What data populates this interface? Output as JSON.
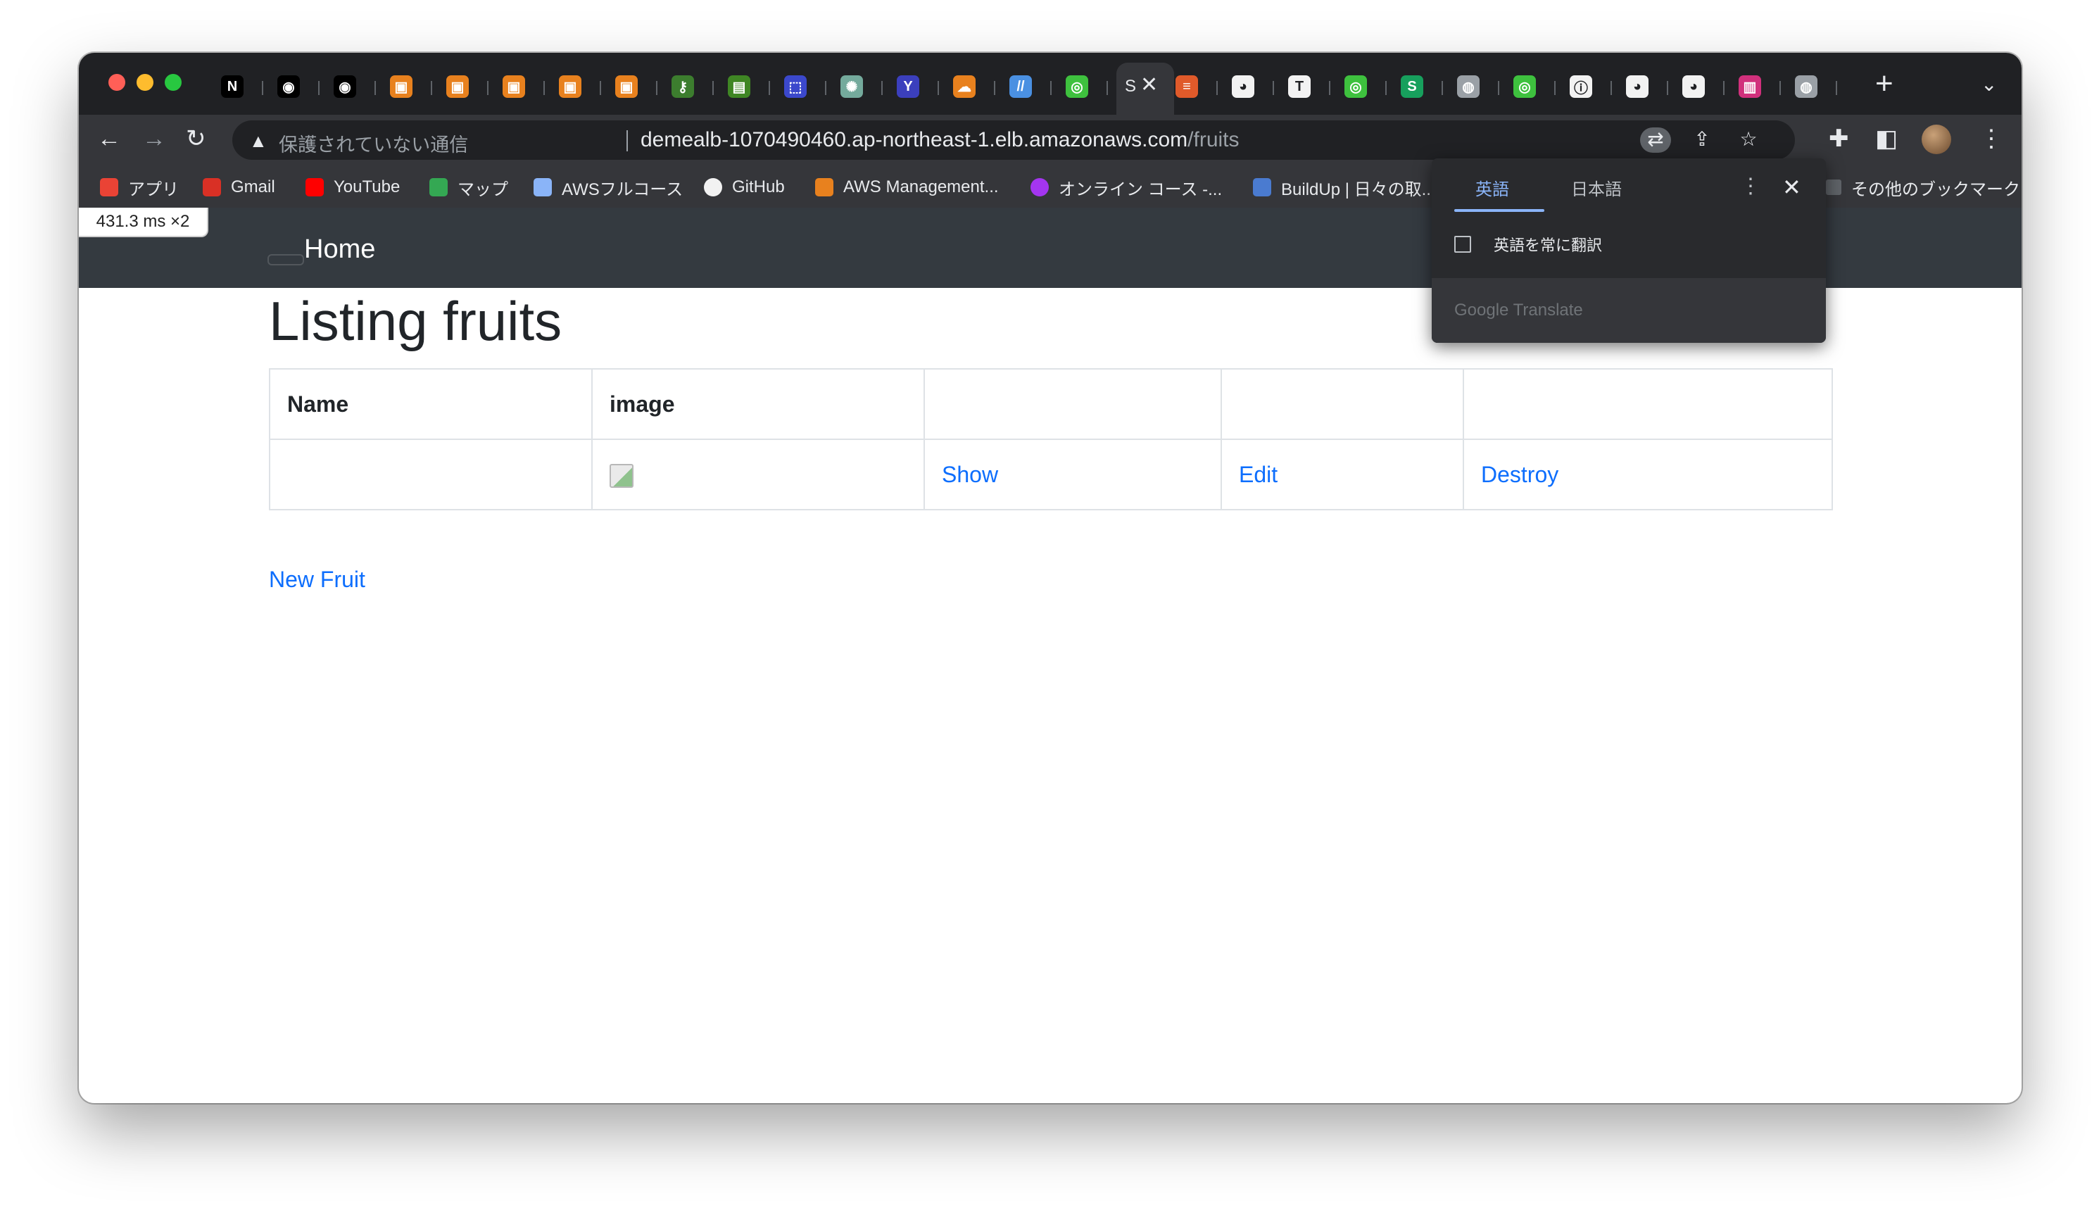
{
  "browser": {
    "tabs": [
      {
        "icon": "notion-icon",
        "color": "#000000",
        "glyph": "N"
      },
      {
        "icon": "github-icon",
        "color": "#000000",
        "glyph": "◉"
      },
      {
        "icon": "github-icon",
        "color": "#000000",
        "glyph": "◉"
      },
      {
        "icon": "aws-icon",
        "color": "#e8811e",
        "glyph": "▣"
      },
      {
        "icon": "aws-icon",
        "color": "#e8811e",
        "glyph": "▣"
      },
      {
        "icon": "aws-icon",
        "color": "#e8811e",
        "glyph": "▣"
      },
      {
        "icon": "aws-icon",
        "color": "#e8811e",
        "glyph": "▣"
      },
      {
        "icon": "aws-icon",
        "color": "#e8811e",
        "glyph": "▣"
      },
      {
        "icon": "key-icon",
        "color": "#3c7d2e",
        "glyph": "⚷"
      },
      {
        "icon": "aws-service-icon",
        "color": "#3f8624",
        "glyph": "▤"
      },
      {
        "icon": "aws-service-icon",
        "color": "#3b48cc",
        "glyph": "⬚"
      },
      {
        "icon": "openai-icon",
        "color": "#74aa9c",
        "glyph": "✺"
      },
      {
        "icon": "yahoo-icon",
        "color": "#3b3fbd",
        "glyph": "Y"
      },
      {
        "icon": "cloud-icon",
        "color": "#e8811e",
        "glyph": "☁"
      },
      {
        "icon": "slash-icon",
        "color": "#4a90e2",
        "glyph": "//"
      },
      {
        "icon": "green-circle-icon",
        "color": "#3ec13e",
        "glyph": "◎"
      },
      {
        "icon": "stackoverflow-icon",
        "color": "#e05a2a",
        "glyph": "≡"
      },
      {
        "icon": "chrome-icon",
        "color": "#f2f2f2",
        "glyph": "◕"
      },
      {
        "icon": "typora-icon",
        "color": "#f2f2f2",
        "glyph": "T"
      },
      {
        "icon": "green-circle-icon",
        "color": "#3ec13e",
        "glyph": "◎"
      },
      {
        "icon": "green-s-icon",
        "color": "#17a05d",
        "glyph": "S"
      },
      {
        "icon": "globe-icon",
        "color": "#9aa0a6",
        "glyph": "◍"
      },
      {
        "icon": "green-circle-icon",
        "color": "#3ec13e",
        "glyph": "◎"
      },
      {
        "icon": "info-icon",
        "color": "#f2f2f2",
        "glyph": "ⓘ"
      },
      {
        "icon": "chrome-icon",
        "color": "#f2f2f2",
        "glyph": "◕"
      },
      {
        "icon": "chrome-icon",
        "color": "#f2f2f2",
        "glyph": "◕"
      },
      {
        "icon": "trello-icon",
        "color": "#d1307c",
        "glyph": "▥"
      },
      {
        "icon": "globe-icon",
        "color": "#9aa0a6",
        "glyph": "◍"
      }
    ],
    "active_tab": {
      "dot": "S",
      "close": "✕"
    },
    "new_tab": "+",
    "security_label": "保護されていない通信",
    "url_host": "demealb-1070490460.ap-northeast-1.elb.amazonaws.com",
    "url_path": "/fruits",
    "bookmarks": [
      {
        "label": "アプリ",
        "icon": "apps-grid-icon",
        "color": "#ea4335"
      },
      {
        "label": "Gmail",
        "icon": "gmail-icon",
        "color": "#d93025"
      },
      {
        "label": "YouTube",
        "icon": "youtube-icon",
        "color": "#ff0000"
      },
      {
        "label": "マップ",
        "icon": "maps-icon",
        "color": "#34a853"
      },
      {
        "label": "AWSフルコース",
        "icon": "aws-course-icon",
        "color": "#8ab4f8"
      },
      {
        "label": "GitHub",
        "icon": "github-icon",
        "color": "#f2f2f2"
      },
      {
        "label": "AWS Management...",
        "icon": "aws-cube-icon",
        "color": "#e8811e"
      },
      {
        "label": "オンライン コース -...",
        "icon": "udemy-icon",
        "color": "#a435f0"
      },
      {
        "label": "BuildUp | 日々の取...",
        "icon": "buildup-icon",
        "color": "#4a7bd0"
      }
    ],
    "other_bookmarks": "その他のブックマーク",
    "perf_badge": "431.3 ms ×2"
  },
  "page": {
    "nav_home": "Home",
    "title": "Listing fruits",
    "table": {
      "headers": [
        "Name",
        "image",
        "",
        "",
        ""
      ],
      "rows": [
        {
          "name": "",
          "show": "Show",
          "edit": "Edit",
          "destroy": "Destroy"
        }
      ]
    },
    "new_link": "New Fruit"
  },
  "translate_popup": {
    "tab_source": "英語",
    "tab_target": "日本語",
    "always_translate": "英語を常に翻訳",
    "footer": "Google Translate",
    "accent": "#8ab4f8"
  }
}
